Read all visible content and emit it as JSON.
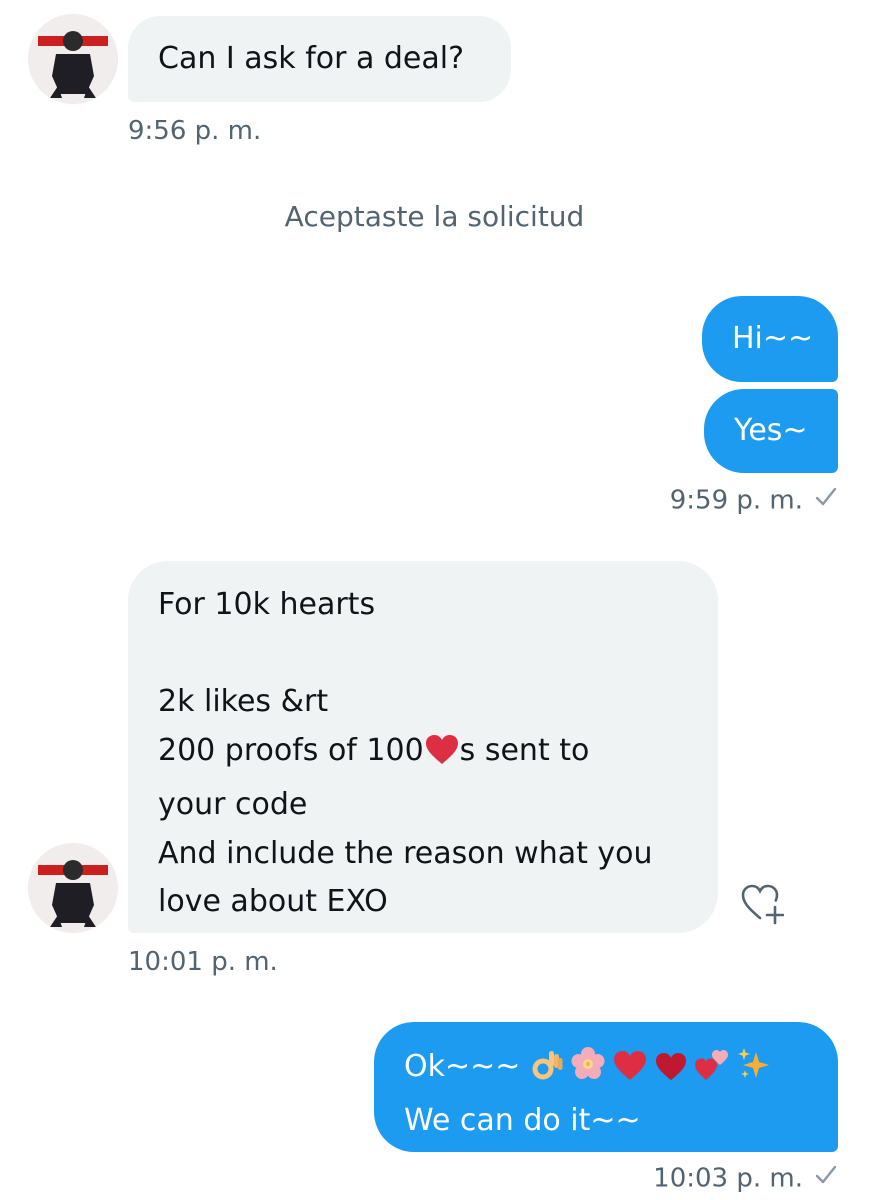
{
  "messages": [
    {
      "text": "Can I ask for a deal?",
      "time": "9:56 p. m."
    },
    {
      "system": "Aceptaste la solicitud"
    },
    {
      "texts": [
        "Hi~~",
        "Yes~"
      ],
      "time": "9:59 p. m."
    },
    {
      "lines": [
        "For 10k hearts",
        "",
        "2k likes &rt",
        "200 proofs of 100",
        "s sent to",
        "your code",
        "And include the reason what you",
        "love about EXO"
      ],
      "time": "10:01 p. m."
    },
    {
      "line1_text": "Ok~~~",
      "line2": "We can do it~~",
      "time": "10:03 p. m."
    }
  ],
  "icons": {
    "sent_check": "check-icon",
    "react": "heart-plus-icon",
    "emoji_row": [
      "ok-hand",
      "cherry-blossom",
      "red-heart",
      "heavy-heart",
      "two-hearts",
      "sparkles"
    ]
  },
  "colors": {
    "incoming_bubble": "#eff3f4",
    "outgoing_bubble": "#1d9bf0",
    "secondary_text": "#536471"
  }
}
